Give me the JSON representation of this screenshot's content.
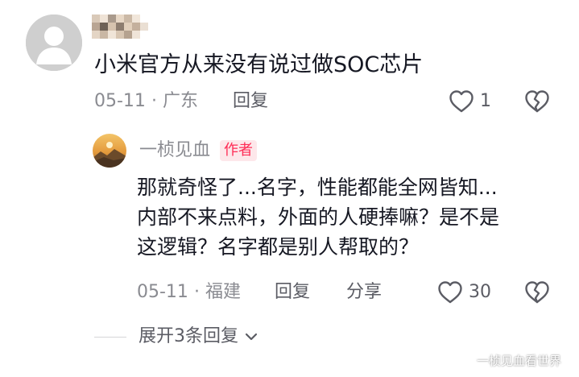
{
  "comment": {
    "text": "小米官方从来没有说过做SOC芯片",
    "date": "05-11",
    "separator": "·",
    "location": "广东",
    "reply_label": "回复",
    "like_count": "1"
  },
  "reply": {
    "author_name": "一桢见血",
    "author_badge": "作者",
    "lines": [
      "那就奇怪了...名字，性能都能全网皆知...",
      "内部不来点料，外面的人硬捧嘛？是不是",
      "这逻辑？名字都是别人帮取的？"
    ],
    "date": "05-11",
    "separator": "·",
    "location": "福建",
    "reply_label": "回复",
    "share_label": "分享",
    "like_count": "30"
  },
  "expand": {
    "label": "展开3条回复"
  },
  "watermark": "一桢见血看世界",
  "colors": {
    "badge_text": "#fe2c55",
    "badge_bg": "#fde7ea",
    "meta_gray": "#8a8b91",
    "text_dark": "#161823"
  },
  "icons": {
    "like": "heart-outline-icon",
    "dislike": "broken-heart-icon",
    "expand": "chevron-down-icon"
  }
}
